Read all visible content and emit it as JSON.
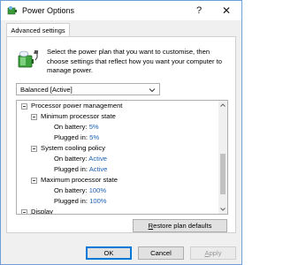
{
  "window": {
    "title": "Power Options",
    "help_glyph": "?",
    "close_glyph": "✕"
  },
  "tabs": [
    {
      "label": "Advanced settings",
      "active": true
    }
  ],
  "description": "Select the power plan that you want to customise, then choose settings that reflect how you want your computer to manage power.",
  "plan_dropdown": {
    "selected": "Balanced [Active]"
  },
  "tree": {
    "root": "Processor power management",
    "groups": [
      {
        "label": "Minimum processor state",
        "items": [
          {
            "label": "On battery:",
            "value": "5%"
          },
          {
            "label": "Plugged in:",
            "value": "5%"
          }
        ]
      },
      {
        "label": "System cooling policy",
        "items": [
          {
            "label": "On battery:",
            "value": "Active"
          },
          {
            "label": "Plugged in:",
            "value": "Active"
          }
        ]
      },
      {
        "label": "Maximum processor state",
        "items": [
          {
            "label": "On battery:",
            "value": "100%"
          },
          {
            "label": "Plugged in:",
            "value": "100%"
          }
        ]
      }
    ],
    "next_root": "Display"
  },
  "buttons": {
    "restore_first": "R",
    "restore_rest": "estore plan defaults",
    "ok": "OK",
    "cancel": "Cancel",
    "apply_first": "A",
    "apply_rest": "pply"
  },
  "colors": {
    "value_text": "#1a5fb4",
    "accent": "#0078d7"
  }
}
